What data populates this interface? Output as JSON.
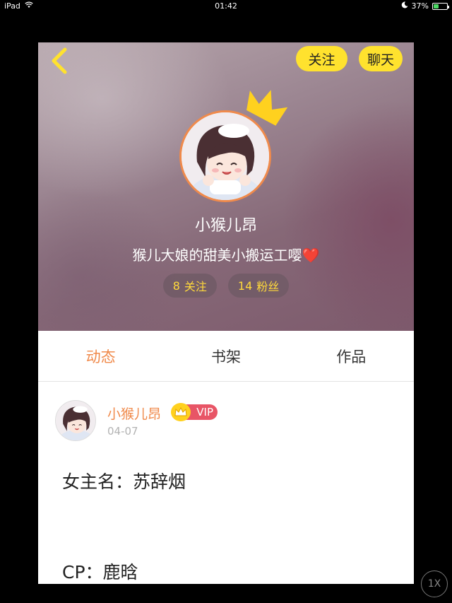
{
  "status_bar": {
    "device": "iPad",
    "time": "01:42",
    "battery_text": "37%",
    "battery_level": 0.37,
    "icons": [
      "wifi-icon",
      "moon-icon",
      "battery-icon"
    ]
  },
  "header": {
    "back_icon": "chevron-left-icon",
    "follow_label": "关注",
    "chat_label": "聊天",
    "username": "小猴儿昂",
    "bio": "猴儿大娘的甜美小搬运工嘤",
    "bio_emoji": "❤️",
    "following_count": "8",
    "following_label": "关注",
    "fans_count": "14",
    "fans_label": "粉丝"
  },
  "tabs": [
    {
      "label": "动态",
      "active": true
    },
    {
      "label": "书架",
      "active": false
    },
    {
      "label": "作品",
      "active": false
    }
  ],
  "post": {
    "author": "小猴儿昂",
    "badge": "VIP",
    "date": "04-07",
    "lines": [
      "女主名：苏辞烟",
      "CP：鹿晗"
    ]
  },
  "player": {
    "rate_label": "1X"
  },
  "colors": {
    "accent": "#f08a4b",
    "button_yellow": "#ffe22e",
    "stat_text": "#ffd93b",
    "vip_red": "#e85566"
  }
}
